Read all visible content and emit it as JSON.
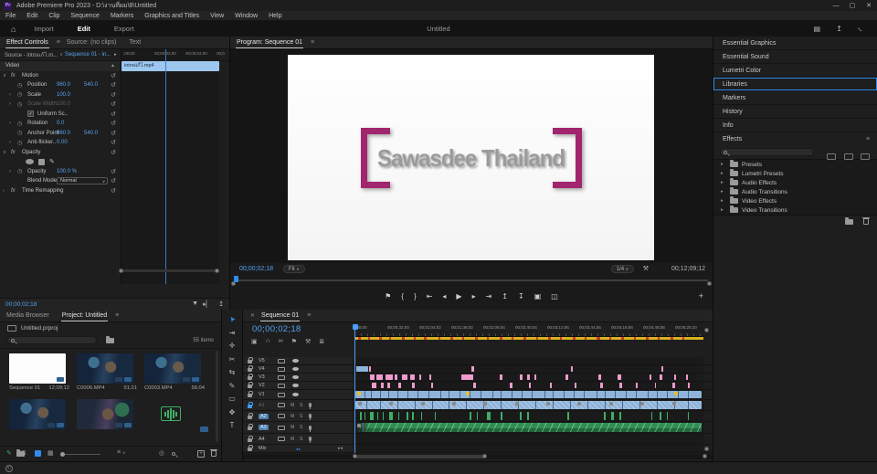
{
  "titlebar": {
    "title": "Adobe Premiere Pro 2023 - D:\\งานที่ผม\\8\\Untitled",
    "minimize": "—",
    "maximize": "▢",
    "close": "✕"
  },
  "menu": {
    "items": [
      "File",
      "Edit",
      "Clip",
      "Sequence",
      "Markers",
      "Graphics and Titles",
      "View",
      "Window",
      "Help"
    ]
  },
  "workspace": {
    "tabs": [
      {
        "label": "Import",
        "active": false
      },
      {
        "label": "Edit",
        "active": true
      },
      {
        "label": "Export",
        "active": false
      }
    ],
    "project": "Untitled"
  },
  "effect_controls": {
    "tabs": [
      {
        "label": "Effect Controls",
        "active": true
      },
      {
        "label": "Source: (no clips)",
        "active": false
      },
      {
        "label": "Text",
        "active": false
      }
    ],
    "source_left": "Source - introแก้ไ.m...",
    "source_right": "Sequence 01 - in...",
    "mini_ruler": [
      ";00;00",
      "00;00;02;00",
      "00;00;04;00",
      "00;0"
    ],
    "clip_name": "introแก้ไ.mp4",
    "video_header": "Video",
    "rows": [
      {
        "kind": "group",
        "label": "Motion"
      },
      {
        "kind": "param",
        "label": "Position",
        "v1": "960.0",
        "v2": "540.0"
      },
      {
        "kind": "param",
        "label": "Scale",
        "v1": "100.0",
        "chev": true
      },
      {
        "kind": "param",
        "label": "Scale Width",
        "v1": "100.0",
        "chev": true,
        "disabled": true
      },
      {
        "kind": "check",
        "label": "Uniform Sc..",
        "checked": true
      },
      {
        "kind": "param",
        "label": "Rotation",
        "v1": "0.0",
        "chev": true
      },
      {
        "kind": "param",
        "label": "Anchor Point",
        "v1": "960.0",
        "v2": "540.0"
      },
      {
        "kind": "param",
        "label": "Anti-flicker..",
        "v1": "0.00",
        "chev": true
      },
      {
        "kind": "group",
        "label": "Opacity"
      },
      {
        "kind": "shapes"
      },
      {
        "kind": "param",
        "label": "Opacity",
        "v1": "100.0 %",
        "chev": true
      },
      {
        "kind": "drop",
        "label": "Blend Mode",
        "value": "Normal"
      },
      {
        "kind": "groupc",
        "label": "Time Remapping"
      }
    ],
    "timecode": "00;00;02;18"
  },
  "program": {
    "tab": "Program: Sequence 01",
    "canvas_text": "Sawasdee Thailand",
    "timecode": "00;00;02;18",
    "fit": "Fit",
    "zoom_level": "1/4",
    "duration": "00;12;09;12",
    "transport": [
      {
        "name": "add-marker-button",
        "g": "⚑"
      },
      {
        "name": "mark-in-button",
        "g": "{"
      },
      {
        "name": "mark-out-button",
        "g": "}"
      },
      {
        "name": "go-to-in-button",
        "g": "⇤"
      },
      {
        "name": "step-back-button",
        "g": "◂"
      },
      {
        "name": "play-button",
        "g": "▶"
      },
      {
        "name": "step-forward-button",
        "g": "▸"
      },
      {
        "name": "go-to-out-button",
        "g": "⇥"
      },
      {
        "name": "lift-button",
        "g": "↥"
      },
      {
        "name": "extract-button",
        "g": "↧"
      },
      {
        "name": "export-frame-button",
        "g": "▣"
      },
      {
        "name": "comparison-view-button",
        "g": "◫"
      }
    ],
    "button_editor": "+"
  },
  "right_panel": {
    "headers": [
      "Essential Graphics",
      "Essential Sound",
      "Lumetri Color",
      "Libraries",
      "Markers",
      "History",
      "Info"
    ],
    "selected": "Libraries",
    "effects_title": "Effects",
    "bins": [
      "Presets",
      "Lumetri Presets",
      "Audio Effects",
      "Audio Transitions",
      "Video Effects",
      "Video Transitions"
    ]
  },
  "project_panel": {
    "tabs": [
      {
        "label": "Media Browser",
        "active": false
      },
      {
        "label": "Project: Untitled",
        "active": true
      }
    ],
    "file": "Untitled.prproj",
    "count": "55 items",
    "items": [
      {
        "name": "Sequence 01",
        "duration": "12;09;12",
        "kind": "sequence"
      },
      {
        "name": "C0006.MP4",
        "duration": "51;21",
        "kind": "video"
      },
      {
        "name": "C0003.MP4",
        "duration": "56;04",
        "kind": "video"
      },
      {
        "name": "",
        "duration": "",
        "kind": "video"
      },
      {
        "name": "",
        "duration": "",
        "kind": "video2"
      },
      {
        "name": "",
        "duration": "",
        "kind": "audio"
      }
    ]
  },
  "tools": [
    {
      "name": "selection-tool",
      "g": "➤",
      "rot": -125,
      "active": true
    },
    {
      "name": "track-select-forward-tool",
      "g": "⇥",
      "rot": 0
    },
    {
      "name": "ripple-edit-tool",
      "g": "✛",
      "rot": 0
    },
    {
      "name": "razor-tool",
      "g": "✂",
      "rot": 0
    },
    {
      "name": "slip-tool",
      "g": "⇆",
      "rot": 0
    },
    {
      "name": "pen-tool",
      "g": "✎",
      "rot": 0
    },
    {
      "name": "rectangle-tool",
      "g": "▭",
      "rot": 0
    },
    {
      "name": "hand-tool",
      "g": "✥",
      "rot": 0
    },
    {
      "name": "type-tool",
      "g": "T",
      "rot": 0
    }
  ],
  "timeline": {
    "tab": "Sequence 01",
    "close": "✕",
    "timecode": "00;00;02;18",
    "toolbar": [
      {
        "name": "nest-toggle",
        "g": "▣"
      },
      {
        "name": "snap-toggle",
        "g": "∩"
      },
      {
        "name": "linked-selection-toggle",
        "g": "∞"
      },
      {
        "name": "add-marker-button",
        "g": "⚑"
      },
      {
        "name": "timeline-settings-button",
        "g": "⚒"
      },
      {
        "name": "captions-button",
        "g": "≣"
      }
    ],
    "ruler": [
      ";00;00",
      "00;00;32;00",
      "00;01;04;02",
      "00;01;36;02",
      "00;02;08;04",
      "00;02;40;04",
      "00;03;12;06",
      "00;03;44;06",
      "00;04;16;08",
      "00;04;48;08",
      "00;05;20;10"
    ],
    "tracks": [
      {
        "id": "V5",
        "type": "video",
        "h": 9
      },
      {
        "id": "V4",
        "type": "video",
        "h": 9
      },
      {
        "id": "V3",
        "type": "video",
        "h": 9
      },
      {
        "id": "V2",
        "type": "video",
        "h": 9
      },
      {
        "id": "V1",
        "type": "video",
        "h": 11
      },
      {
        "id": "A1",
        "type": "audio",
        "h": 12,
        "locked": true,
        "dim": true
      },
      {
        "id": "A2",
        "type": "audio",
        "h": 12,
        "target": true
      },
      {
        "id": "A3",
        "type": "audio",
        "h": 13,
        "target": true
      },
      {
        "id": "A4",
        "type": "audio",
        "h": 12
      },
      {
        "id": "Mix",
        "type": "master",
        "h": 9
      }
    ],
    "clips": {
      "V4": {
        "segments": [
          {
            "c": "blue",
            "x": 0.5,
            "w": 3.5
          },
          {
            "c": "pink",
            "x": 4.3,
            "w": 0.5
          },
          {
            "c": "pink",
            "x": 33.6,
            "w": 0.6
          },
          {
            "c": "pink",
            "x": 62,
            "w": 0.5
          },
          {
            "c": "pink",
            "x": 88,
            "w": 0.5
          }
        ]
      },
      "V3": {
        "segments": [
          {
            "c": "pink",
            "x": 4.5,
            "w": 1.2
          },
          {
            "c": "pink",
            "x": 6.2,
            "w": 2.0
          },
          {
            "c": "pink",
            "x": 8.8,
            "w": 2.2
          },
          {
            "c": "pink",
            "x": 11.5,
            "w": 0.8
          },
          {
            "c": "pink",
            "x": 13.5,
            "w": 1.8
          },
          {
            "c": "pink",
            "x": 16,
            "w": 1.2
          },
          {
            "c": "pink",
            "x": 18.5,
            "w": 0.6
          },
          {
            "c": "pink",
            "x": 21.5,
            "w": 0.6
          },
          {
            "c": "pink",
            "x": 30.5,
            "w": 3.6
          },
          {
            "c": "pink",
            "x": 41.5,
            "w": 0.9
          },
          {
            "c": "pink",
            "x": 47.5,
            "w": 0.7
          },
          {
            "c": "pink",
            "x": 49.5,
            "w": 0.7
          },
          {
            "c": "pink",
            "x": 51.5,
            "w": 0.7
          },
          {
            "c": "pink",
            "x": 60.5,
            "w": 0.8
          },
          {
            "c": "pink",
            "x": 70,
            "w": 0.7
          },
          {
            "c": "pink",
            "x": 75.5,
            "w": 0.9
          },
          {
            "c": "pink",
            "x": 84.5,
            "w": 0.7
          },
          {
            "c": "pink",
            "x": 87.5,
            "w": 0.8
          },
          {
            "c": "pink",
            "x": 91.5,
            "w": 0.7
          },
          {
            "c": "pink",
            "x": 95,
            "w": 0.6
          }
        ]
      },
      "V2": {
        "segments": [
          {
            "c": "pink",
            "x": 5,
            "w": 1.4
          },
          {
            "c": "pink",
            "x": 7.5,
            "w": 1.0
          },
          {
            "c": "pink",
            "x": 9.5,
            "w": 0.7
          },
          {
            "c": "pink",
            "x": 12.5,
            "w": 0.8
          },
          {
            "c": "pink",
            "x": 16.5,
            "w": 0.7
          },
          {
            "c": "pink",
            "x": 22,
            "w": 0.6
          },
          {
            "c": "pink",
            "x": 34,
            "w": 0.8
          },
          {
            "c": "pink",
            "x": 44.5,
            "w": 0.7
          },
          {
            "c": "pink",
            "x": 50,
            "w": 0.6
          },
          {
            "c": "pink",
            "x": 56,
            "w": 0.6
          },
          {
            "c": "pink",
            "x": 63,
            "w": 0.5
          },
          {
            "c": "pink",
            "x": 70.5,
            "w": 0.7
          },
          {
            "c": "pink",
            "x": 76,
            "w": 0.6
          },
          {
            "c": "pink",
            "x": 80.5,
            "w": 0.6
          },
          {
            "c": "pink",
            "x": 86,
            "w": 0.5
          },
          {
            "c": "pink",
            "x": 91,
            "w": 0.8
          },
          {
            "c": "pink",
            "x": 95.5,
            "w": 0.5
          }
        ]
      },
      "V1": {
        "bar": "blue",
        "cuts": [
          2.5,
          4.5,
          7,
          9.5,
          12,
          15,
          18,
          21,
          24.5,
          27,
          30,
          33,
          36,
          39.5,
          42,
          45,
          48,
          51,
          54.5,
          57,
          60,
          63,
          66,
          69.5,
          72,
          75,
          78,
          81,
          84.5,
          87,
          90,
          93,
          96
        ],
        "ybadges": [
          0.8,
          32,
          91.5
        ]
      },
      "A1": {
        "bar": "blue-hatch",
        "cuts": [
          3,
          7,
          12,
          17,
          22,
          27,
          32,
          37,
          42,
          47,
          52,
          57,
          62,
          67,
          72,
          77,
          82,
          87,
          92,
          96
        ],
        "gbadges": [
          1,
          10,
          19,
          28,
          37,
          46,
          55,
          64,
          73,
          82,
          91
        ]
      },
      "A2": {
        "segments": [
          {
            "c": "green",
            "x": 1.5,
            "w": 0.5
          },
          {
            "c": "green",
            "x": 2.8,
            "w": 0.4
          },
          {
            "c": "green",
            "x": 4.5,
            "w": 0.9
          },
          {
            "c": "green",
            "x": 6.5,
            "w": 0.4
          },
          {
            "c": "green",
            "x": 8,
            "w": 0.4
          },
          {
            "c": "green",
            "x": 10,
            "w": 1.0
          },
          {
            "c": "green",
            "x": 12.5,
            "w": 0.4
          },
          {
            "c": "green",
            "x": 15,
            "w": 0.5
          },
          {
            "c": "green",
            "x": 16.5,
            "w": 0.4
          },
          {
            "c": "green",
            "x": 19,
            "w": 0.5
          },
          {
            "c": "green",
            "x": 23,
            "w": 0.4
          },
          {
            "c": "green",
            "x": 33,
            "w": 0.5
          },
          {
            "c": "green",
            "x": 35,
            "w": 0.4
          },
          {
            "c": "green",
            "x": 38,
            "w": 0.9
          },
          {
            "c": "green",
            "x": 42,
            "w": 0.4
          },
          {
            "c": "green",
            "x": 47.5,
            "w": 0.5
          },
          {
            "c": "green",
            "x": 49.5,
            "w": 0.4
          },
          {
            "c": "green",
            "x": 61,
            "w": 0.4
          },
          {
            "c": "green",
            "x": 71.5,
            "w": 0.5
          },
          {
            "c": "green",
            "x": 73.5,
            "w": 0.9
          },
          {
            "c": "green",
            "x": 76,
            "w": 0.4
          },
          {
            "c": "green",
            "x": 85,
            "w": 0.4
          },
          {
            "c": "green",
            "x": 87.5,
            "w": 0.5
          },
          {
            "c": "green",
            "x": 89.5,
            "w": 0.4
          },
          {
            "c": "green",
            "x": 95.5,
            "w": 0.4
          }
        ]
      },
      "A3": {
        "bar": "green-chevron",
        "cuts": [
          2
        ],
        "gbadges": [
          0.8
        ]
      },
      "A4": {
        "segments": []
      },
      "Mix": {
        "segments": []
      }
    },
    "render_red": [
      [
        1,
        0.8
      ],
      [
        4,
        0.5
      ],
      [
        7,
        0.8
      ],
      [
        10,
        0.5
      ],
      [
        13.5,
        0.8
      ],
      [
        17,
        0.5
      ],
      [
        20,
        0.8
      ],
      [
        24,
        0.5
      ],
      [
        27.5,
        0.8
      ],
      [
        31,
        0.5
      ],
      [
        34.5,
        0.8
      ],
      [
        38,
        0.5
      ],
      [
        41.5,
        0.8
      ],
      [
        45,
        0.5
      ],
      [
        48.5,
        0.8
      ],
      [
        52,
        0.5
      ],
      [
        55.5,
        0.8
      ],
      [
        59,
        0.5
      ],
      [
        62.5,
        0.8
      ],
      [
        66,
        0.5
      ],
      [
        69.5,
        0.8
      ],
      [
        73,
        0.5
      ],
      [
        76.5,
        0.8
      ],
      [
        80,
        0.5
      ],
      [
        83.5,
        0.8
      ],
      [
        87,
        0.5
      ],
      [
        90.5,
        0.8
      ],
      [
        94,
        0.5
      ]
    ]
  },
  "colors": {
    "accent_blue": "#2f8ceb",
    "timecode_blue": "#53a2f3",
    "value_blue": "#5aa2ee",
    "clip_blue": "#8fb3da",
    "clip_pink": "#ee9bcd",
    "audio_green": "#2f8f52",
    "render_yellow": "#d7b31e",
    "render_red": "#cf3a2b",
    "bracket_magenta": "#a1266e",
    "canvas_text_gray": "#9b9b9b",
    "pen_green": "#3fae63"
  }
}
